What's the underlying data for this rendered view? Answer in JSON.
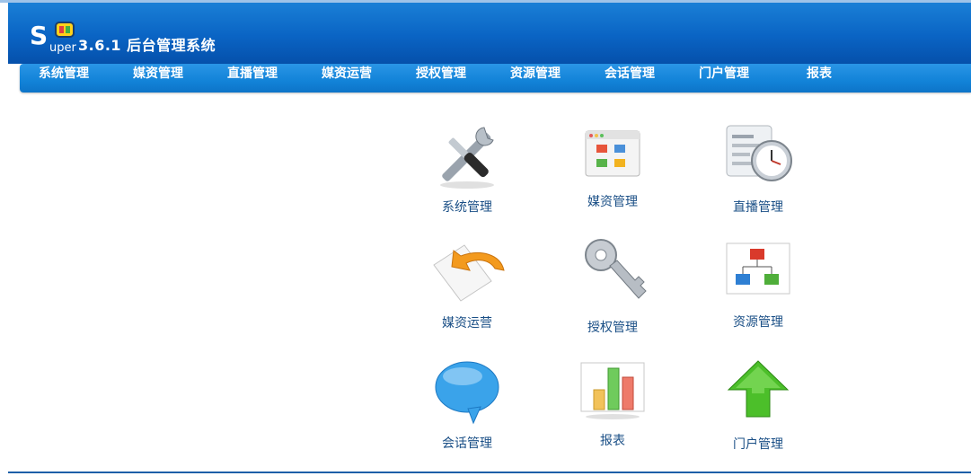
{
  "logo": {
    "letter": "S",
    "word": "uper"
  },
  "app_title": "3.6.1 后台管理系统",
  "nav": {
    "items": [
      "系统管理",
      "媒资管理",
      "直播管理",
      "媒资运营",
      "授权管理",
      "资源管理",
      "会话管理",
      "门户管理",
      "报表"
    ]
  },
  "tiles": [
    {
      "label": "系统管理",
      "icon": "tools-icon"
    },
    {
      "label": "媒资管理",
      "icon": "media-window-icon"
    },
    {
      "label": "直播管理",
      "icon": "schedule-clock-icon"
    },
    {
      "label": "媒资运营",
      "icon": "return-arrow-icon"
    },
    {
      "label": "授权管理",
      "icon": "key-icon"
    },
    {
      "label": "资源管理",
      "icon": "hierarchy-icon"
    },
    {
      "label": "会话管理",
      "icon": "chat-bubble-icon"
    },
    {
      "label": "报表",
      "icon": "bar-chart-icon"
    },
    {
      "label": "门户管理",
      "icon": "up-arrow-icon"
    }
  ],
  "colors": {
    "header": "#0a64c4",
    "nav": "#1283d8",
    "label": "#1a4f86"
  }
}
